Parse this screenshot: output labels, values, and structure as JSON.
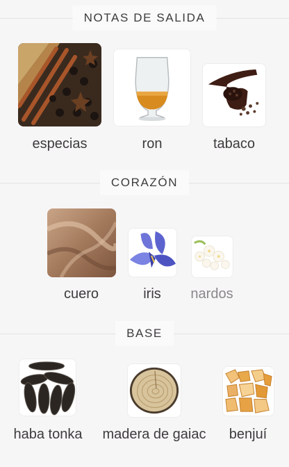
{
  "sections": [
    {
      "title": "NOTAS DE SALIDA",
      "notes": [
        {
          "label": "especias",
          "icon": "spices-icon"
        },
        {
          "label": "ron",
          "icon": "rum-glass-icon"
        },
        {
          "label": "tabaco",
          "icon": "tobacco-pipe-icon"
        }
      ]
    },
    {
      "title": "CORAZÓN",
      "notes": [
        {
          "label": "cuero",
          "icon": "leather-icon"
        },
        {
          "label": "iris",
          "icon": "iris-flower-icon"
        },
        {
          "label": "nardos",
          "icon": "tuberose-icon"
        }
      ]
    },
    {
      "title": "BASE",
      "notes": [
        {
          "label": "haba tonka",
          "icon": "tonka-bean-icon"
        },
        {
          "label": "madera de gaiac",
          "icon": "guaiac-wood-icon"
        },
        {
          "label": "benjuí",
          "icon": "benzoin-resin-icon"
        }
      ]
    }
  ],
  "colors": {
    "background": "#f7f6f7",
    "text": "#3d3b3d",
    "faded_text": "#8a888a",
    "divider": "#e4e2e4"
  }
}
